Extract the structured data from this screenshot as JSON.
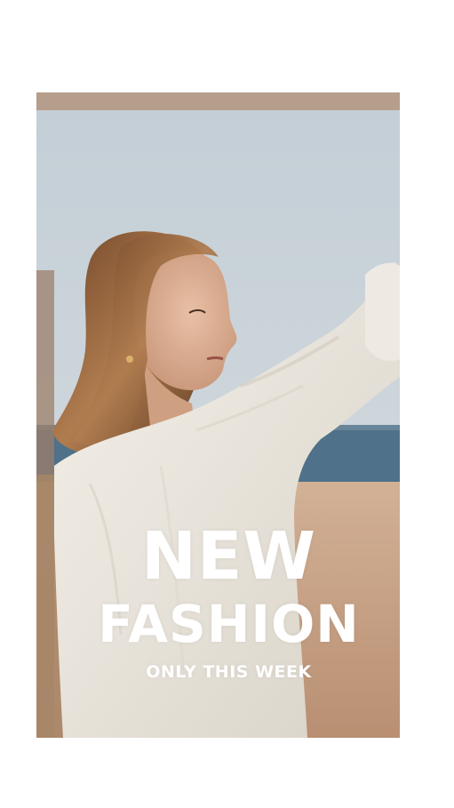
{
  "poster": {
    "headline_line1": "NEW",
    "headline_line2": "FASHION",
    "tagline": "ONLY THIS WEEK"
  },
  "colors": {
    "page_background": "#ffffff",
    "sky": "#c9d3da",
    "sand": "#c9a284",
    "sea": "#4f7189",
    "blouse": "#eeebe4",
    "hair": "#8a5a36",
    "text": "#ffffff"
  }
}
